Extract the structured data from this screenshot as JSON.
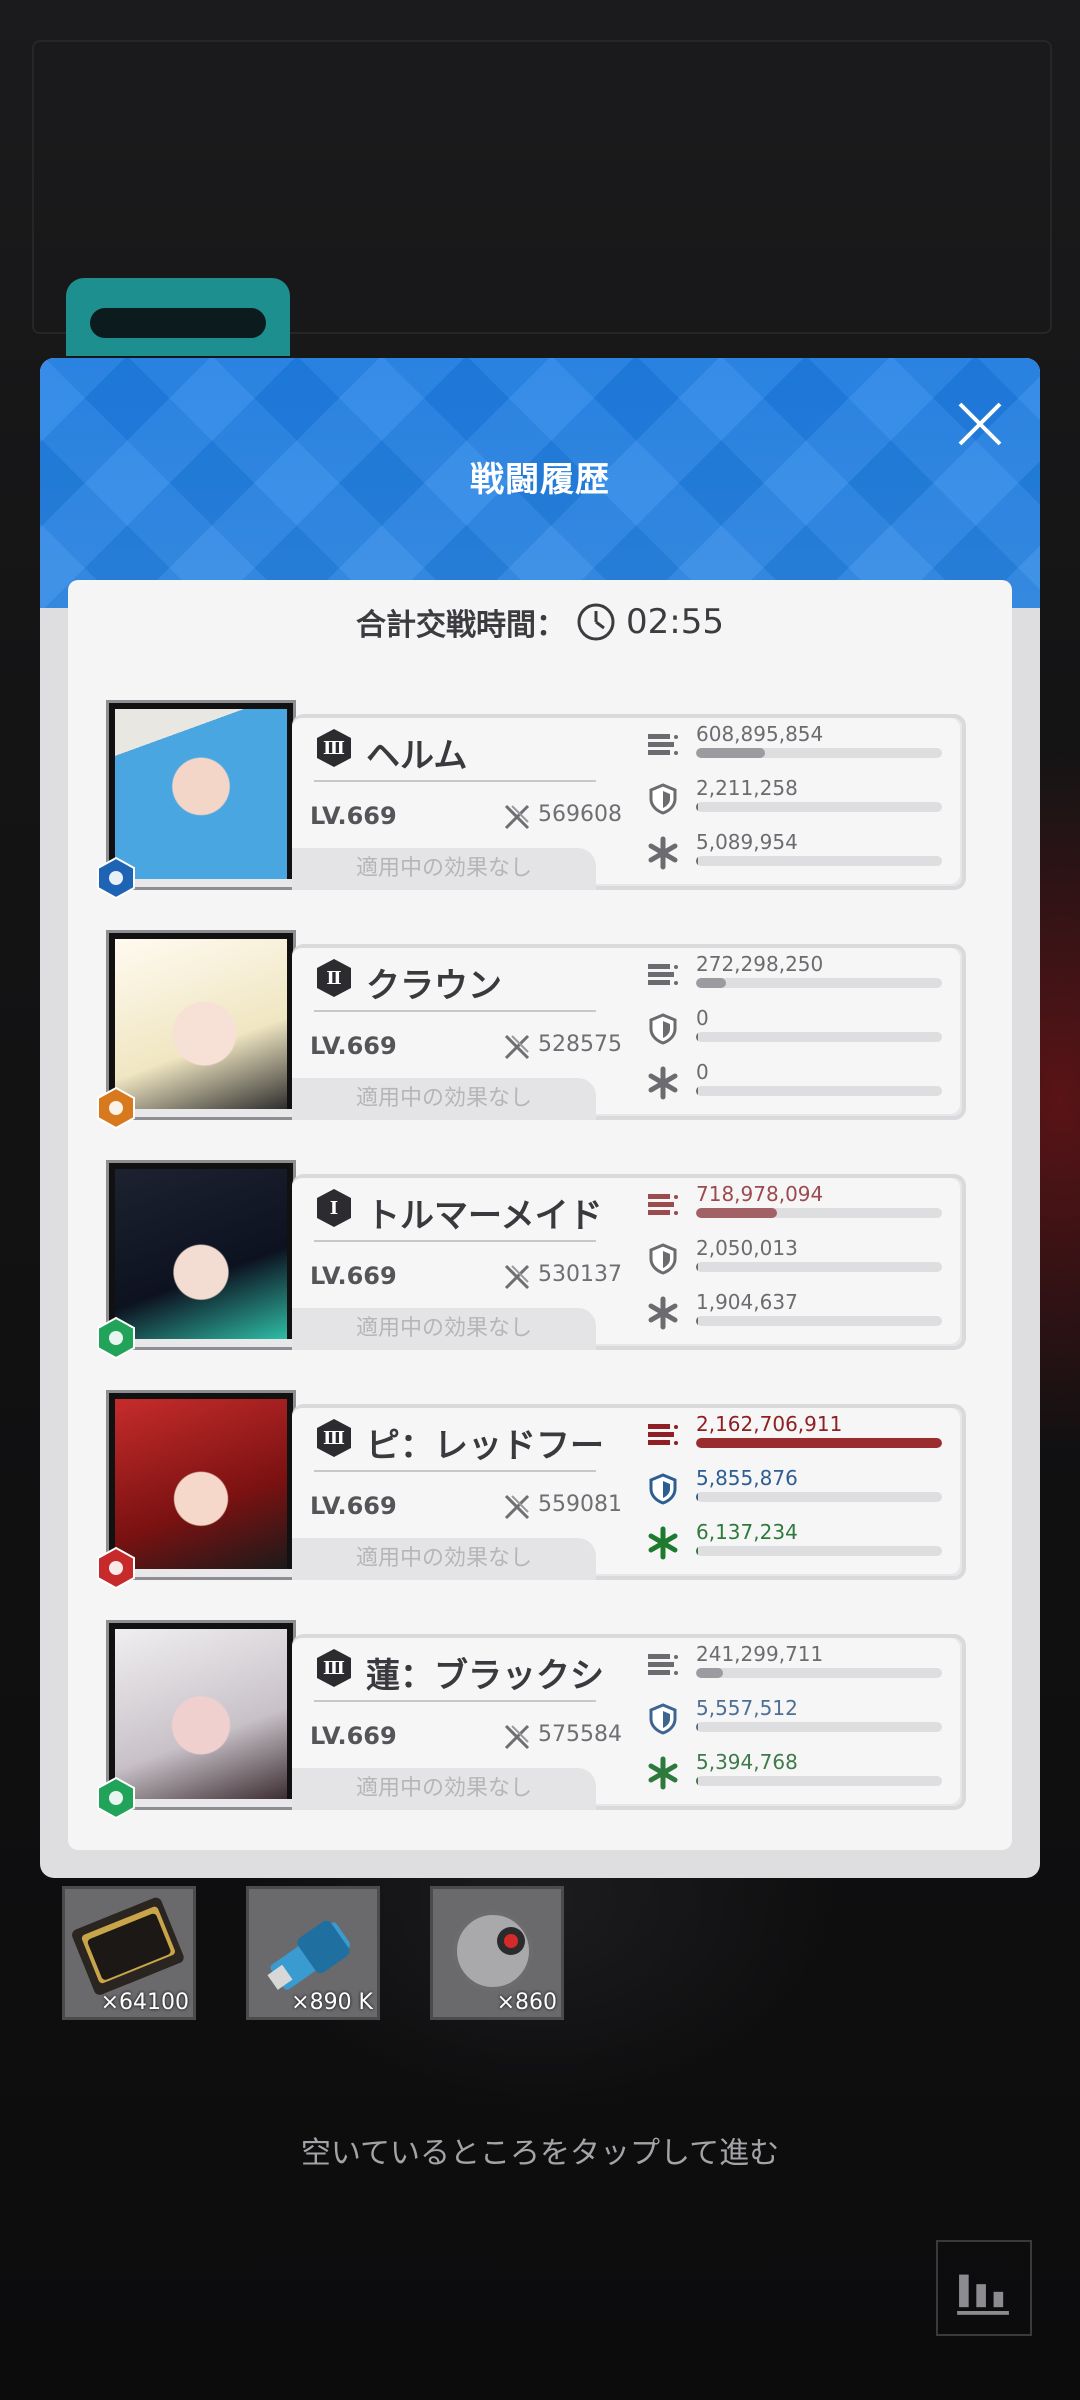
{
  "modal": {
    "title": "戦闘履歴"
  },
  "total": {
    "label": "合計交戦時間：",
    "time": "02:55"
  },
  "effect_label": "適用中の効果なし",
  "characters": [
    {
      "burst": "Ⅲ",
      "name": "ヘルム",
      "level": "LV.669",
      "combat_power": "569608",
      "element": "water",
      "element_color": "#1f63b5",
      "damage": "608,895,854",
      "damage_ratio": 0.28,
      "damage_color": "#9c9ca0",
      "defense": "2,211,258",
      "defense_ratio": 0.0,
      "heal": "5,089,954",
      "heal_ratio": 0.0,
      "highlight": "none"
    },
    {
      "burst": "Ⅱ",
      "name": "クラウン",
      "level": "LV.669",
      "combat_power": "528575",
      "element": "iron",
      "element_color": "#d9791d",
      "damage": "272,298,250",
      "damage_ratio": 0.12,
      "damage_color": "#9c9ca0",
      "defense": "0",
      "defense_ratio": 0.0,
      "heal": "0",
      "heal_ratio": 0.0,
      "highlight": "none"
    },
    {
      "burst": "Ⅰ",
      "name": "トルマーメイド",
      "level": "LV.669",
      "combat_power": "530137",
      "element": "wind",
      "element_color": "#21a35a",
      "damage": "718,978,094",
      "damage_ratio": 0.33,
      "damage_color": "#a26164",
      "defense": "2,050,013",
      "defense_ratio": 0.0,
      "heal": "1,904,637",
      "heal_ratio": 0.0,
      "highlight": "damage_soft"
    },
    {
      "burst": "Ⅲ",
      "name": "ピ：レッドフード",
      "level": "LV.669",
      "combat_power": "559081",
      "element": "fire",
      "element_color": "#c72a2a",
      "damage": "2,162,706,911",
      "damage_ratio": 1.0,
      "damage_color": "#9b2c2e",
      "defense": "5,855,876",
      "defense_ratio": 0.0,
      "heal": "6,137,234",
      "heal_ratio": 0.0,
      "highlight": "all"
    },
    {
      "burst": "Ⅲ",
      "name": "蓮：ブラックシャドウ",
      "level": "LV.669",
      "combat_power": "575584",
      "element": "wind",
      "element_color": "#21a35a",
      "damage": "241,299,711",
      "damage_ratio": 0.11,
      "damage_color": "#9c9ca0",
      "defense": "5,557,512",
      "defense_ratio": 0.0,
      "heal": "5,394,768",
      "heal_ratio": 0.0,
      "highlight": "defense_heal"
    }
  ],
  "rewards": [
    {
      "icon": "credit-card-item",
      "count": "×64100"
    },
    {
      "icon": "core-dust-usb-item",
      "count": "×890 K"
    },
    {
      "icon": "battle-data-sphere-item",
      "count": "×860"
    }
  ],
  "hint": "空いているところをタップして進む"
}
